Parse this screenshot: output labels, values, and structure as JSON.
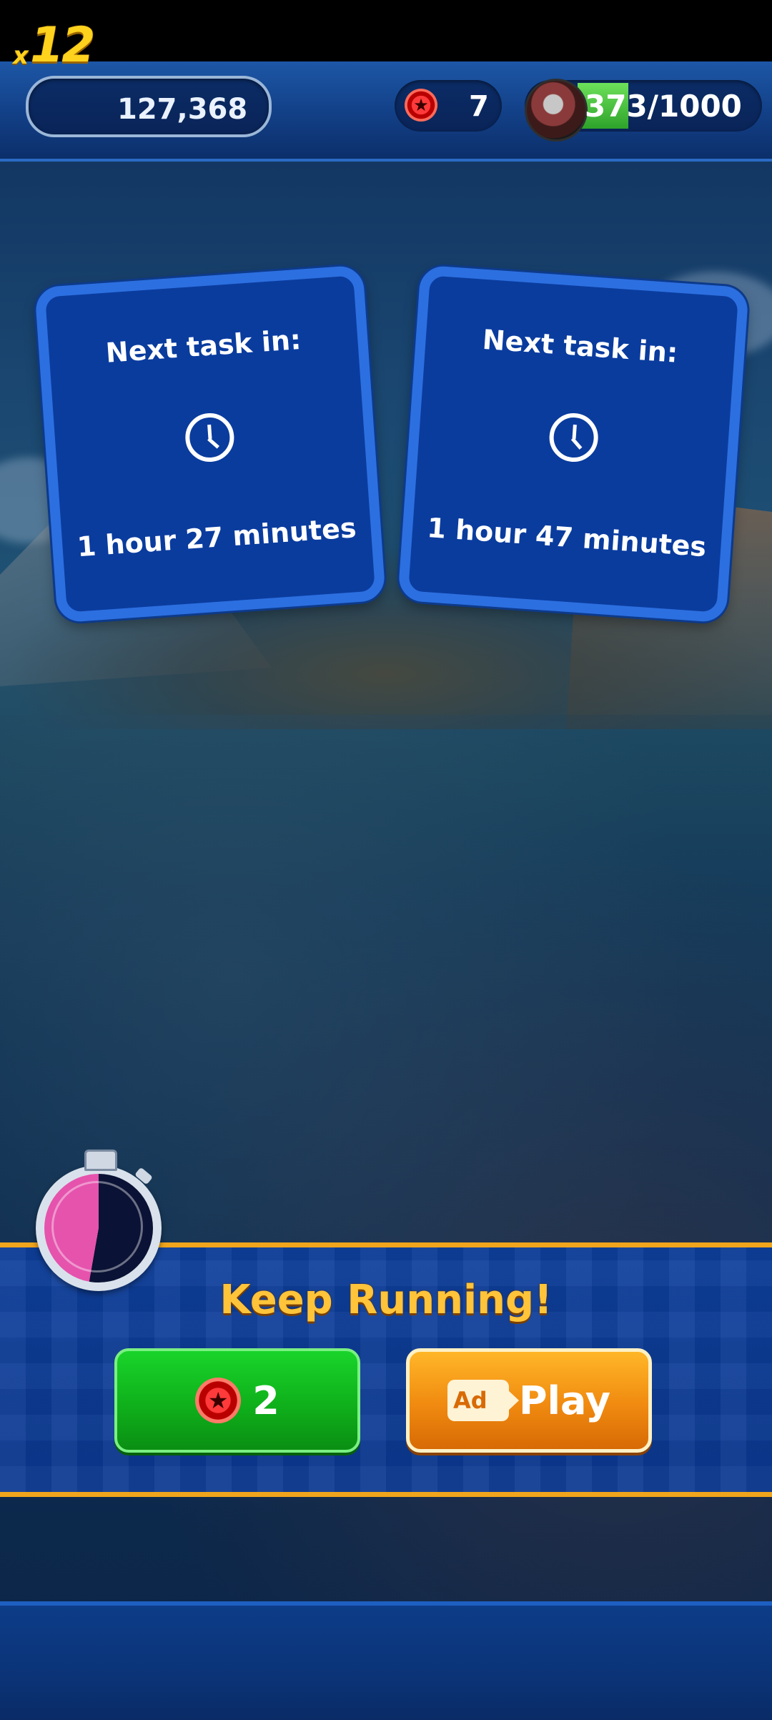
{
  "hud": {
    "multiplier_prefix": "x",
    "multiplier_value": "12",
    "score": "127,368",
    "red_star_rings": "7",
    "energy": "373/1000",
    "energy_fill_fraction": 0.373
  },
  "tasks": [
    {
      "label": "Next task in:",
      "time": "1 hour 27 minutes"
    },
    {
      "label": "Next task in:",
      "time": "1 hour 47 minutes"
    }
  ],
  "continue_panel": {
    "title": "Keep Running!",
    "cost_button_value": "2",
    "ad_badge": "Ad",
    "ad_button_label": "Play",
    "timer_remaining_fraction": 0.47
  },
  "colors": {
    "accent_gold": "#f0a51c",
    "card_blue": "#0a3c9e",
    "green_button": "#0fb01b",
    "orange_button": "#f08a10"
  }
}
